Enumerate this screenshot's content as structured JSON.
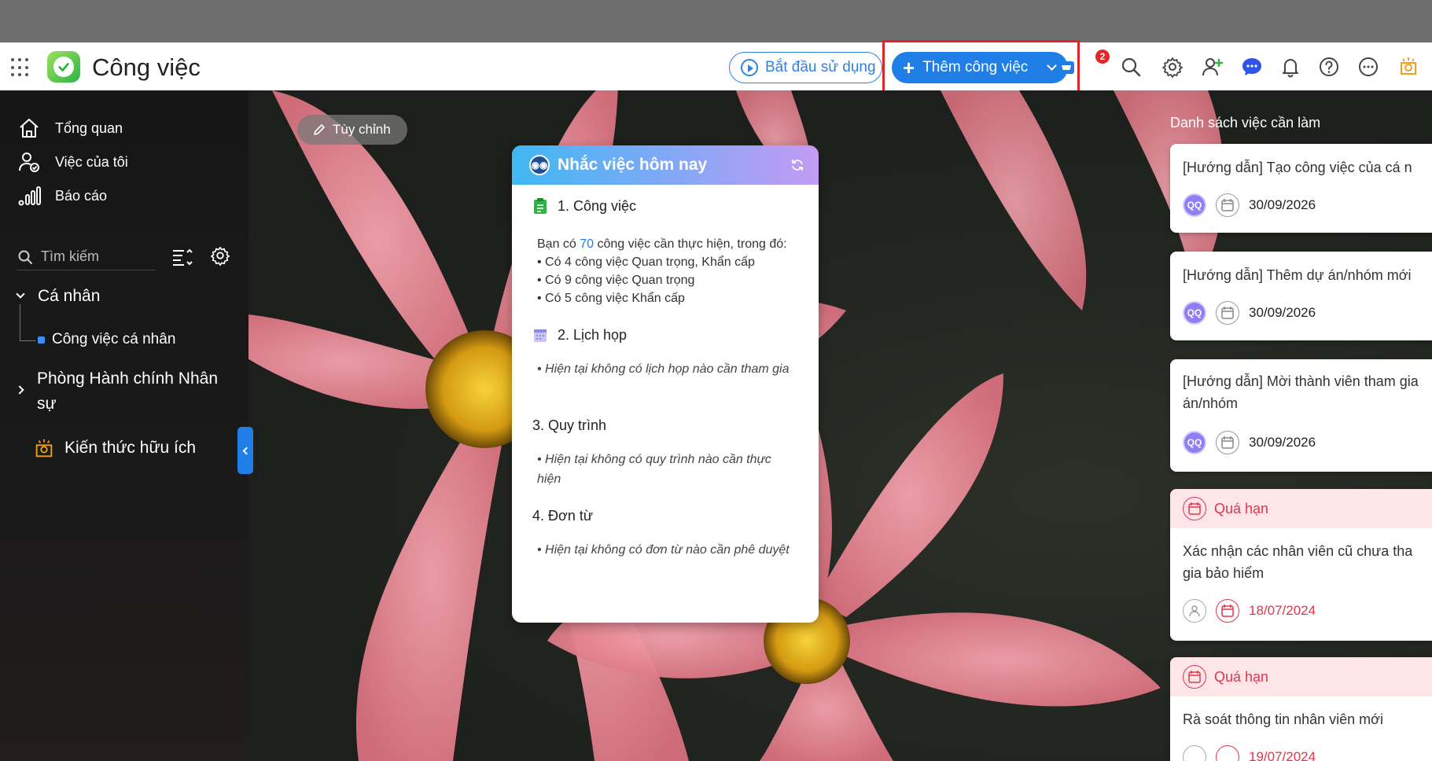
{
  "header": {
    "app_title": "Công việc",
    "start_label": "Bắt đầu sử dụng",
    "add_task_label": "Thêm công việc",
    "cart_badge": "2"
  },
  "sidebar": {
    "items": [
      {
        "label": "Tổng quan",
        "icon": "home-icon"
      },
      {
        "label": "Việc của tôi",
        "icon": "user-check-icon"
      },
      {
        "label": "Báo cáo",
        "icon": "chart-icon"
      }
    ],
    "search_placeholder": "Tìm kiếm",
    "tree": {
      "personal_label": "Cá nhân",
      "personal_child": "Công việc cá nhân",
      "department_label": "Phòng Hành chính Nhân sự"
    },
    "knowledge_label": "Kiến thức hữu ích"
  },
  "main": {
    "customize_label": "Tùy chỉnh",
    "reminder": {
      "title": "Nhắc việc hôm nay",
      "sections": [
        {
          "title": "1. Công việc"
        },
        {
          "title": "2. Lịch họp",
          "text": "• Hiện tại không có lịch họp nào cần tham gia"
        },
        {
          "title": "3. Quy trình",
          "text": "• Hiện tại không có quy trình nào cần thực hiện"
        },
        {
          "title": "4. Đơn từ",
          "text": "• Hiện tại không có đơn từ nào cần phê duyệt"
        }
      ],
      "work_prefix": "Bạn có ",
      "work_count": "70",
      "work_suffix": " công việc cần thực hiện, trong đó:",
      "work_lines": [
        "• Có 4 công việc Quan trọng, Khẩn cấp",
        "• Có 9 công việc Quan trọng",
        "• Có 5 công việc Khẩn cấp"
      ]
    }
  },
  "todo": {
    "title": "Danh sách việc cần làm",
    "overdue_label": "Quá hạn",
    "tasks": [
      {
        "title": "[Hướng dẫn] Tạo công việc của cá n",
        "avatar": "QQ",
        "date": "30/09/2026"
      },
      {
        "title": "[Hướng dẫn] Thêm dự án/nhóm mới",
        "avatar": "QQ",
        "date": "30/09/2026"
      },
      {
        "title_line1": "[Hướng dẫn] Mời thành viên tham gia",
        "title_line2": "án/nhóm",
        "avatar": "QQ",
        "date": "30/09/2026"
      },
      {
        "title_line1": "Xác nhận các nhân viên cũ chưa tha",
        "title_line2": "gia bảo hiểm",
        "date": "18/07/2024"
      },
      {
        "title": "Rà soát thông tin nhân viên mới",
        "date": "19/07/2024"
      }
    ]
  },
  "colors": {
    "accent": "#1f7fe6",
    "overdue": "#e0364a",
    "highlight_frame": "#e02424"
  }
}
